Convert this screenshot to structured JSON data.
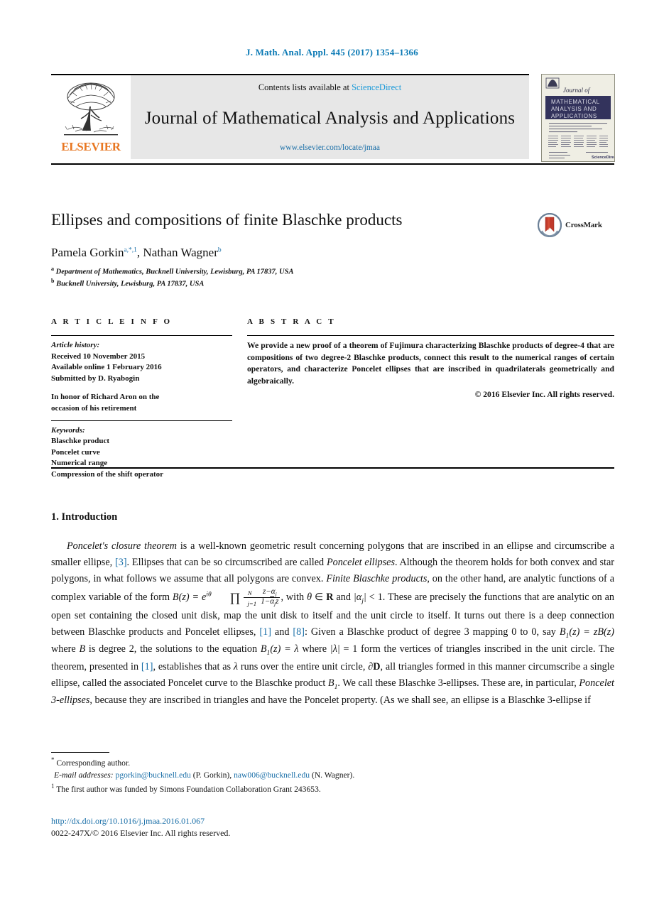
{
  "running_head": "J. Math. Anal. Appl. 445 (2017) 1354–1366",
  "banner": {
    "contents_prefix": "Contents lists available at ",
    "contents_link": "ScienceDirect",
    "journal_title": "Journal of Mathematical Analysis and Applications",
    "journal_url": "www.elsevier.com/locate/jmaa",
    "publisher": "ELSEVIER",
    "cover": {
      "journal_of": "Journal of",
      "line1": "MATHEMATICAL",
      "line2": "ANALYSIS AND",
      "line3": "APPLICATIONS"
    }
  },
  "article": {
    "title": "Ellipses and compositions of finite Blaschke products",
    "crossmark_label": "CrossMark",
    "authors_plain": "Pamela Gorkin",
    "author1": "Pamela Gorkin",
    "author1_marks": "a,*,1",
    "author2": "Nathan Wagner",
    "author2_marks": "b",
    "affiliation_a_mark": "a",
    "affiliation_a": "Department of Mathematics, Bucknell University, Lewisburg, PA 17837, USA",
    "affiliation_b_mark": "b",
    "affiliation_b": "Bucknell University, Lewisburg, PA 17837, USA"
  },
  "info": {
    "heading": "A R T I C L E    I N F O",
    "history_label": "Article history:",
    "received": "Received 10 November 2015",
    "available": "Available online 1 February 2016",
    "submitted": "Submitted by D. Ryabogin",
    "dedication_line1": "In honor of Richard Aron on the",
    "dedication_line2": "occasion of his retirement",
    "keywords_label": "Keywords:",
    "keywords": [
      "Blaschke product",
      "Poncelet curve",
      "Numerical range",
      "Compression of the shift operator"
    ]
  },
  "abstract": {
    "heading": "A B S T R A C T",
    "text": "We provide a new proof of a theorem of Fujimura characterizing Blaschke products of degree-4 that are compositions of two degree-2 Blaschke products, connect this result to the numerical ranges of certain operators, and characterize Poncelet ellipses that are inscribed in quadrilaterals geometrically and algebraically.",
    "copyright": "© 2016 Elsevier Inc. All rights reserved."
  },
  "body": {
    "section_title": "1. Introduction",
    "p1_a": "Poncelet's closure theorem",
    "p1_b": " is a well-known geometric result concerning polygons that are inscribed in an ellipse and circumscribe a smaller ellipse, ",
    "ref3": "[3]",
    "p1_c": ". Ellipses that can be so circumscribed are called ",
    "p1_d": "Poncelet ellipses",
    "p1_e": ". Although the theorem holds for both convex and star polygons, in what follows we assume that all polygons are convex. ",
    "p1_f": "Finite Blaschke products",
    "p1_g": ", on the other hand, are analytic functions of a complex variable of the form ",
    "p1_h": ", with ",
    "p1_i": " and ",
    "p1_j": ". These are precisely the functions that are analytic on an open set containing the closed unit disk, map the unit disk to itself and the unit circle to itself. It turns out there is a deep connection between Blaschke products and Poncelet ellipses, ",
    "ref1": "[1]",
    "p1_k": " and ",
    "ref8": "[8]",
    "p1_l": ": Given a Blaschke product of degree 3 mapping 0 to 0, say ",
    "p1_m": " where ",
    "p1_n": " is degree 2, the solutions to the equation ",
    "p1_o": " where ",
    "p1_p": " form the vertices of triangles inscribed in the unit circle. The theorem, presented in ",
    "p1_q": ", establishes that as ",
    "p1_r": " runs over the entire unit circle, ",
    "p1_s": ", all triangles formed in this manner circumscribe a single ellipse, called the associated Poncelet curve to the Blaschke product ",
    "p1_t": ". We call these Blaschke 3-ellipses. These are, in particular, ",
    "p1_u": "Poncelet 3-ellipses",
    "p1_v": ", because they are inscribed in triangles and have the Poncelet property. (As we shall see, an ellipse is a Blaschke 3-ellipse if"
  },
  "footnotes": {
    "star": "*",
    "corresponding": "Corresponding author.",
    "email_label": "E-mail addresses:",
    "email1": "pgorkin@bucknell.edu",
    "email1_who": "(P. Gorkin),",
    "email2": "naw006@bucknell.edu",
    "email2_who": "(N. Wagner).",
    "note1_mark": "1",
    "note1": "The first author was funded by Simons Foundation Collaboration Grant 243653."
  },
  "footer": {
    "doi": "http://dx.doi.org/10.1016/j.jmaa.2016.01.067",
    "issn_line": "0022-247X/© 2016 Elsevier Inc. All rights reserved."
  },
  "colors": {
    "link": "#1a6fa8",
    "running_head": "#0b7ab5",
    "elsevier_orange": "#e87722",
    "banner_gray": "#e7e7e7"
  }
}
